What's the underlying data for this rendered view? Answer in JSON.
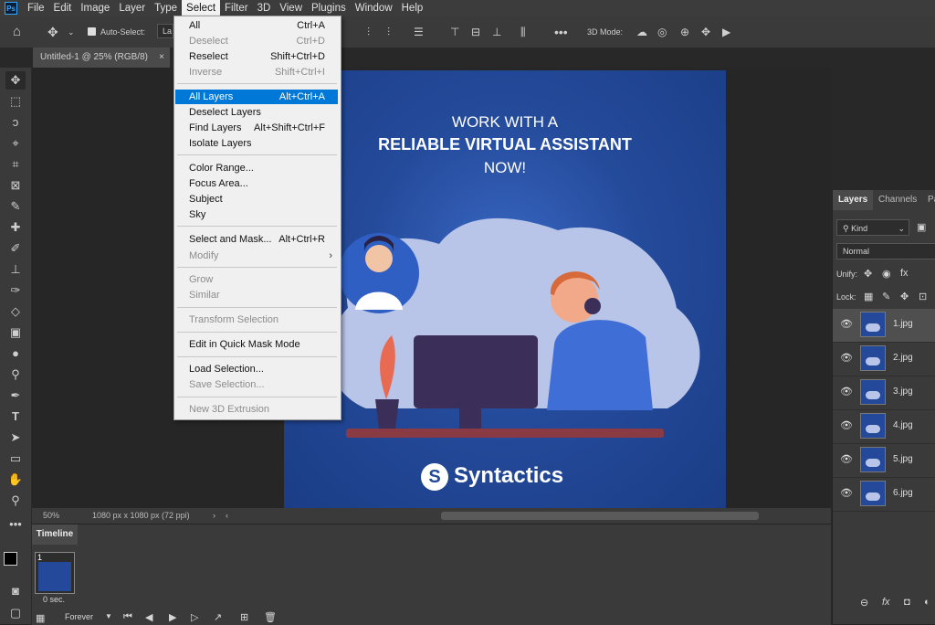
{
  "menubar": {
    "logo": "Ps",
    "items": [
      "File",
      "Edit",
      "Image",
      "Layer",
      "Type",
      "Select",
      "Filter",
      "3D",
      "View",
      "Plugins",
      "Window",
      "Help"
    ],
    "active": "Select"
  },
  "options_bar": {
    "auto_select_label": "Auto-Select:",
    "auto_select_value": "La",
    "mode_3d_label": "3D Mode:"
  },
  "document": {
    "tab_title": "Untitled-1 @ 25% (RGB/8)",
    "tab_close": "×",
    "zoom": "50%",
    "size_info": "1080 px x 1080 px (72 ppi)"
  },
  "artwork": {
    "line1": "WORK WITH A",
    "line2": "RELIABLE VIRTUAL ASSISTANT",
    "line3": "NOW!",
    "brand": "Syntactics",
    "colors": {
      "bg_center": "#3a68c4",
      "bg_edge": "#1b3d86",
      "cloud": "#b9c5e8",
      "shirt": "#3f6fd6",
      "desk": "#8a3a42",
      "monitor": "#3b2f5a"
    }
  },
  "select_menu": {
    "items": [
      {
        "label": "All",
        "shortcut": "Ctrl+A",
        "state": "normal"
      },
      {
        "label": "Deselect",
        "shortcut": "Ctrl+D",
        "state": "disabled"
      },
      {
        "label": "Reselect",
        "shortcut": "Shift+Ctrl+D",
        "state": "normal"
      },
      {
        "label": "Inverse",
        "shortcut": "Shift+Ctrl+I",
        "state": "disabled"
      },
      {
        "label": "All Layers",
        "shortcut": "Alt+Ctrl+A",
        "state": "highlighted"
      },
      {
        "label": "Deselect Layers",
        "shortcut": "",
        "state": "normal"
      },
      {
        "label": "Find Layers",
        "shortcut": "Alt+Shift+Ctrl+F",
        "state": "normal"
      },
      {
        "label": "Isolate Layers",
        "shortcut": "",
        "state": "normal"
      },
      {
        "label": "Color Range...",
        "shortcut": "",
        "state": "normal"
      },
      {
        "label": "Focus Area...",
        "shortcut": "",
        "state": "normal"
      },
      {
        "label": "Subject",
        "shortcut": "",
        "state": "normal"
      },
      {
        "label": "Sky",
        "shortcut": "",
        "state": "normal"
      },
      {
        "label": "Select and Mask...",
        "shortcut": "Alt+Ctrl+R",
        "state": "normal"
      },
      {
        "label": "Modify",
        "shortcut": "",
        "state": "disabled",
        "submenu": true
      },
      {
        "label": "Grow",
        "shortcut": "",
        "state": "disabled"
      },
      {
        "label": "Similar",
        "shortcut": "",
        "state": "disabled"
      },
      {
        "label": "Transform Selection",
        "shortcut": "",
        "state": "disabled"
      },
      {
        "label": "Edit in Quick Mask Mode",
        "shortcut": "",
        "state": "normal"
      },
      {
        "label": "Load Selection...",
        "shortcut": "",
        "state": "normal"
      },
      {
        "label": "Save Selection...",
        "shortcut": "",
        "state": "disabled"
      },
      {
        "label": "New 3D Extrusion",
        "shortcut": "",
        "state": "disabled"
      }
    ],
    "submenu_arrow": "›"
  },
  "timeline": {
    "title": "Timeline",
    "frame_number": "1",
    "frame_delay": "0 sec.",
    "loop": "Forever"
  },
  "layers_panel": {
    "tabs": [
      "Layers",
      "Channels",
      "Pa"
    ],
    "filter_kind": "Kind",
    "blend_mode": "Normal",
    "unify_label": "Unify:",
    "lock_label": "Lock:",
    "fx_label": "fx",
    "layers": [
      "1.jpg",
      "2.jpg",
      "3.jpg",
      "4.jpg",
      "5.jpg",
      "6.jpg"
    ],
    "selected": "1.jpg"
  }
}
